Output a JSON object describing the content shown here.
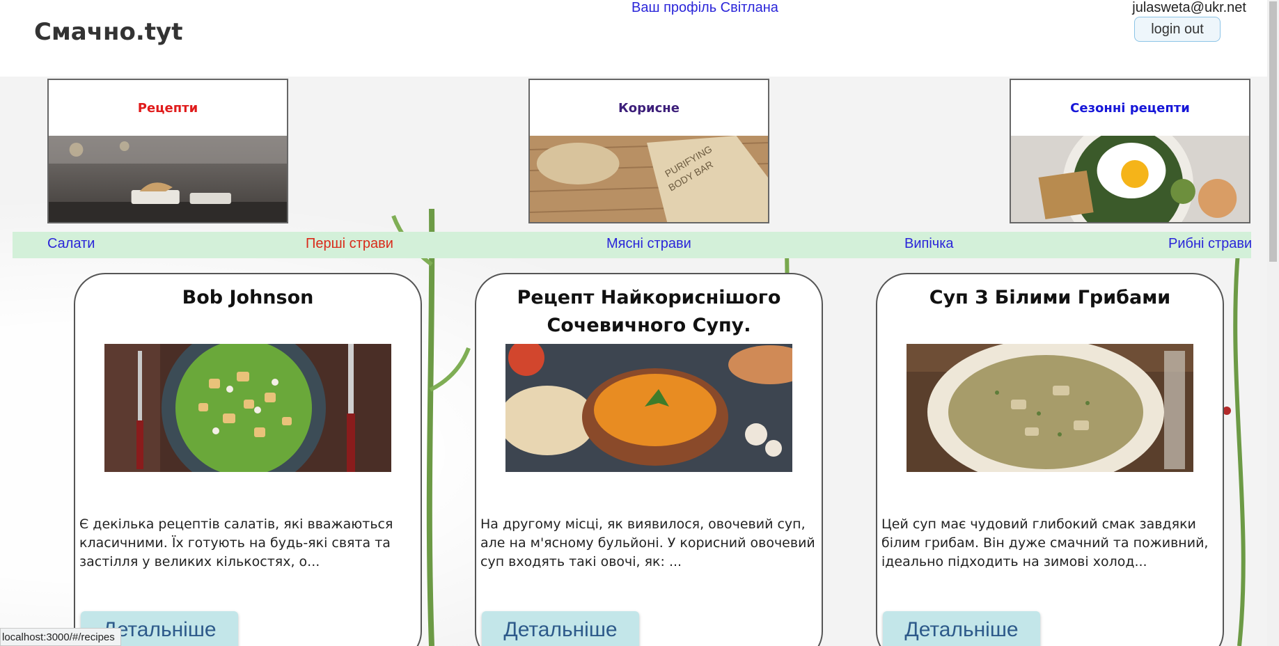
{
  "header": {
    "logo": "Смачно.tyt",
    "profile_link": "Ваш профіль Світлана",
    "email": "julasweta@ukr.net",
    "logout_label": "login out"
  },
  "categories": [
    {
      "title": "Рецепти",
      "color": "#e01b1b",
      "image": "food-court-photo"
    },
    {
      "title": "Корисне",
      "color": "#3d1f7a",
      "image": "soap-bar-photo"
    },
    {
      "title": "Сезонні рецепти",
      "color": "#1616d8",
      "image": "egg-bowl-photo"
    }
  ],
  "nav": [
    {
      "label": "Салати",
      "color": "#2a25d9"
    },
    {
      "label": "Перші страви",
      "color": "#d92a1a"
    },
    {
      "label": "Мясні страви",
      "color": "#2a25d9"
    },
    {
      "label": "Випічка",
      "color": "#2a25d9"
    },
    {
      "label": "Рибні страви",
      "color": "#2a25d9"
    }
  ],
  "recipes": [
    {
      "title": "Bob Johnson",
      "image": "caesar-salad-photo",
      "description": "Є декілька рецептів салатів, які вважаються класичними. Їх готують на будь-які свята та застілля у великих кількостях, о...",
      "button": "Детальніше"
    },
    {
      "title": "Рецепт Найкориснішого Сочевичного Супу.",
      "image": "lentil-soup-photo",
      "description": "На другому місці, як виявилося, овочевий суп, але на м'ясному бульйоні. У корисний овочевий суп входять такі овочі, як: ...",
      "button": "Детальніше"
    },
    {
      "title": "Суп З Білими Грибами",
      "image": "mushroom-soup-photo",
      "description": "Цей суп має чудовий глибокий смак завдяки білим грибам. Він дуже смачний та поживний, ідеально підходить на зимові холод...",
      "button": "Детальніше"
    }
  ],
  "status_url": "localhost:3000/#/recipes"
}
